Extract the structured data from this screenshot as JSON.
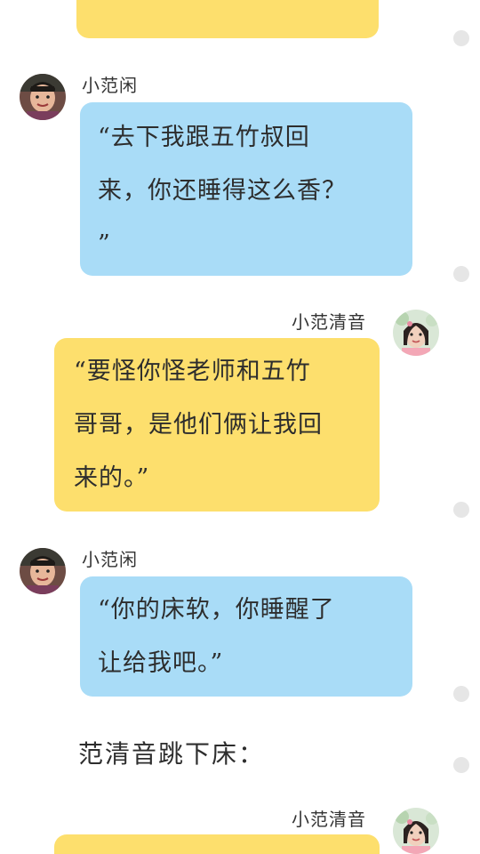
{
  "messages": [
    {
      "sender": "小范闲",
      "text": "“去下我跟五竹叔回\n来，你还睡得这么香？\n”"
    },
    {
      "sender": "小范清音",
      "text": "“要怪你怪老师和五竹\n哥哥，是他们俩让我回\n来的。”"
    },
    {
      "sender": "小范闲",
      "text": "“你的床软，你睡醒了\n让给我吧。”"
    }
  ],
  "narration": "范清音跳下床：",
  "last_sender": "小范清音",
  "colors": {
    "blue_bubble": "#a9dcf7",
    "yellow_bubble": "#fddf6d",
    "dot": "#e6e6e6"
  },
  "icons": [
    "avatar-boy",
    "avatar-girl",
    "side-dot"
  ]
}
